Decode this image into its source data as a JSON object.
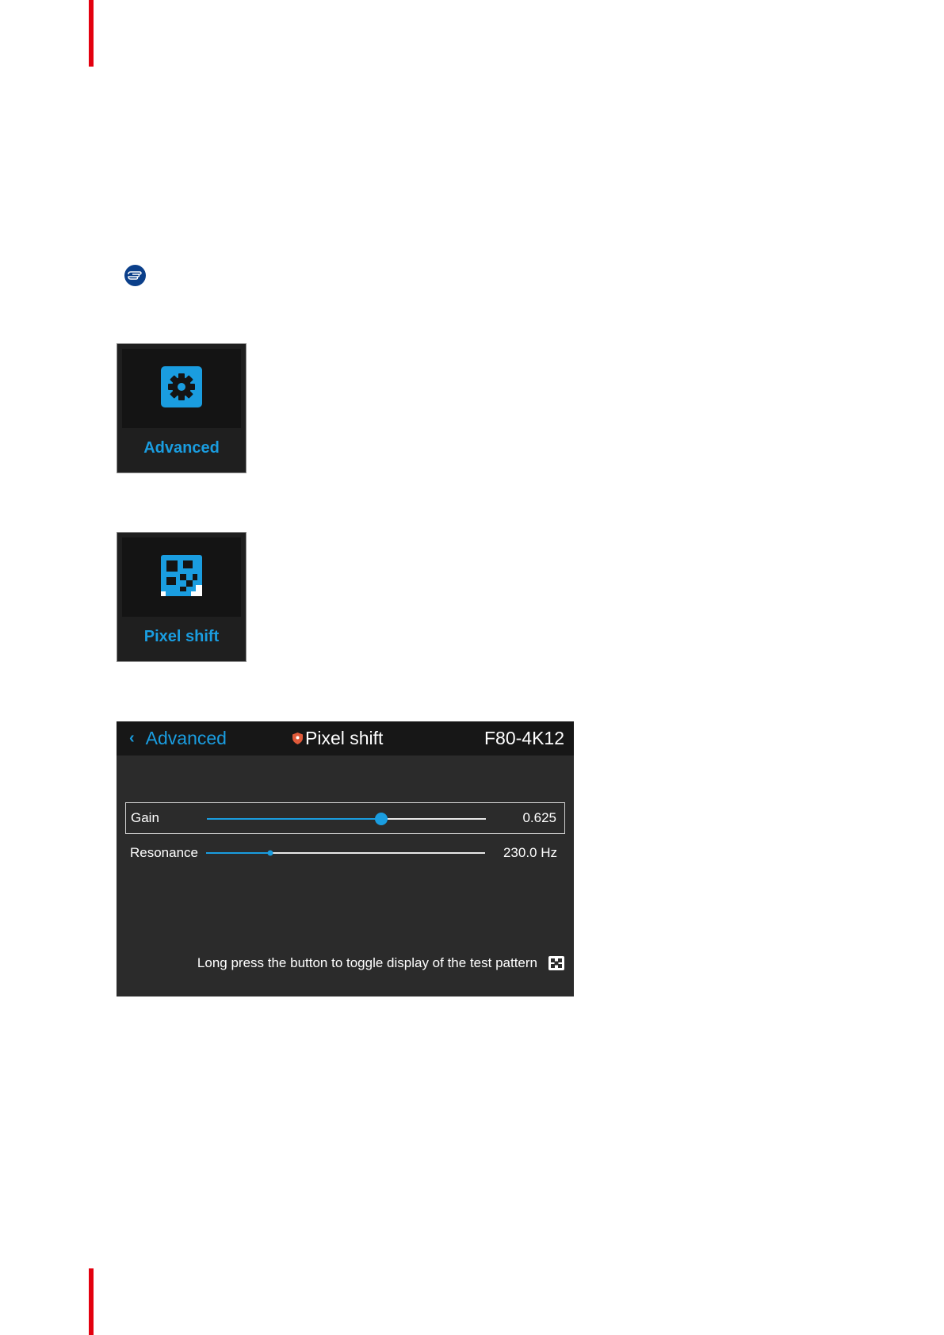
{
  "tiles": {
    "advanced": {
      "label": "Advanced",
      "icon": "gear-icon"
    },
    "pixel_shift": {
      "label": "Pixel shift",
      "icon": "pixel-shift-icon"
    }
  },
  "note_icon": "pointing-hand-icon",
  "screen": {
    "header": {
      "back_label": "Advanced",
      "title": "Pixel shift",
      "model": "F80-4K12"
    },
    "settings": {
      "gain": {
        "label": "Gain",
        "value": "0.625",
        "level": 0.625,
        "selected": true
      },
      "resonance": {
        "label": "Resonance",
        "value": "230.0 Hz",
        "level": 0.23,
        "selected": false
      }
    },
    "hint": "Long press the button to toggle display of the test pattern"
  },
  "colors": {
    "accent": "#1a9de0",
    "brand_red": "#e3000f",
    "note_blue": "#0b3f8a",
    "shield": "#e05a3a"
  }
}
